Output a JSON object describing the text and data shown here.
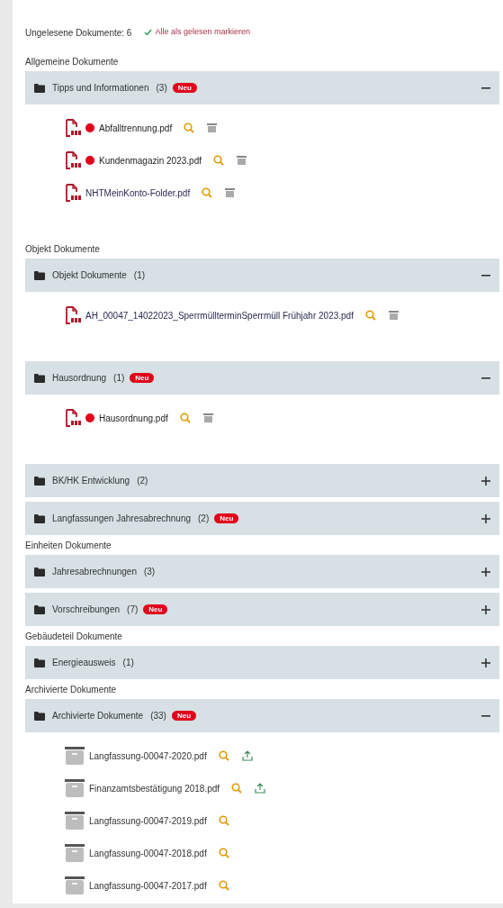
{
  "unread_summary": "Ungelesene Dokumente: 6",
  "mark_all_read": "Alle als gelesen markieren",
  "sections": [
    {
      "title": "Allgemeine Dokumente",
      "groups": [
        {
          "name": "Tipps und Informationen",
          "count": "(3)",
          "badge": "Neu",
          "expanded": true,
          "files": [
            {
              "kind": "pdf",
              "name": "Abfalltrennung.pdf",
              "unread": true,
              "actions": [
                {
                  "kind": "view"
                },
                {
                  "kind": "archive"
                }
              ]
            },
            {
              "kind": "pdf",
              "name": "Kundenmagazin 2023.pdf",
              "unread": true,
              "actions": [
                {
                  "kind": "view"
                },
                {
                  "kind": "archive"
                }
              ]
            },
            {
              "kind": "pdf",
              "name": "NHTMeinKonto-Folder.pdf",
              "unread": false,
              "actions": [
                {
                  "kind": "view"
                },
                {
                  "kind": "archive"
                }
              ]
            }
          ]
        }
      ]
    },
    {
      "title": "Objekt Dokumente",
      "groups": [
        {
          "name": "Objekt Dokumente",
          "count": "(1)",
          "expanded": true,
          "files": [
            {
              "kind": "pdf",
              "name": "AH_00047_14022023_SperrmüllterminSperrmüll Frühjahr 2023.pdf",
              "unread": false,
              "actions": [
                {
                  "kind": "view"
                },
                {
                  "kind": "archive"
                }
              ]
            }
          ]
        },
        {
          "name": "Hausordnung",
          "count": "(1)",
          "badge": "Neu",
          "expanded": true,
          "files": [
            {
              "kind": "pdf",
              "name": "Hausordnung.pdf",
              "unread": true,
              "actions": [
                {
                  "kind": "view"
                },
                {
                  "kind": "archive"
                }
              ]
            }
          ]
        },
        {
          "name": "BK/HK Entwicklung",
          "count": "(2)",
          "expanded": false
        },
        {
          "name": "Langfassungen Jahresabrechnung",
          "count": "(2)",
          "badge": "Neu",
          "expanded": false
        }
      ]
    },
    {
      "title": "Einheiten Dokumente",
      "groups": [
        {
          "name": "Jahresabrechnungen",
          "count": "(3)",
          "expanded": false
        },
        {
          "name": "Vorschreibungen",
          "count": "(7)",
          "badge": "Neu",
          "expanded": false
        }
      ]
    },
    {
      "title": "Gebäudeteil Dokumente",
      "groups": [
        {
          "name": "Energieausweis",
          "count": "(1)",
          "expanded": false
        }
      ]
    },
    {
      "title": "Archivierte Dokumente",
      "groups": [
        {
          "name": "Archivierte Dokumente",
          "count": "(33)",
          "badge": "Neu",
          "expanded": true,
          "files": [
            {
              "kind": "archived",
              "name": "Langfassung-00047-2020.pdf",
              "unread": false,
              "actions": [
                {
                  "kind": "view"
                },
                {
                  "kind": "restore"
                }
              ]
            },
            {
              "kind": "archived",
              "name": "Finanzamtsbestätigung 2018.pdf",
              "unread": false,
              "actions": [
                {
                  "kind": "view"
                },
                {
                  "kind": "restore"
                }
              ]
            },
            {
              "kind": "archived",
              "name": "Langfassung-00047-2019.pdf",
              "unread": false,
              "actions": [
                {
                  "kind": "view"
                }
              ]
            },
            {
              "kind": "archived",
              "name": "Langfassung-00047-2018.pdf",
              "unread": false,
              "actions": [
                {
                  "kind": "view"
                }
              ]
            },
            {
              "kind": "archived",
              "name": "Langfassung-00047-2017.pdf",
              "unread": false,
              "actions": [
                {
                  "kind": "view"
                }
              ]
            }
          ]
        }
      ]
    }
  ]
}
